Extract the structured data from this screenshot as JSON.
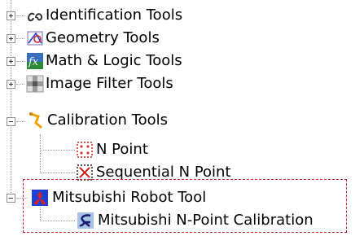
{
  "tree": {
    "items": [
      {
        "label": "Identification Tools",
        "state": "collapsed",
        "icon": "identification-icon"
      },
      {
        "label": "Geometry Tools",
        "state": "collapsed",
        "icon": "geometry-icon"
      },
      {
        "label": "Math & Logic Tools",
        "state": "collapsed",
        "icon": "math-logic-icon"
      },
      {
        "label": "Image Filter Tools",
        "state": "collapsed",
        "icon": "image-filter-icon"
      },
      {
        "label": "Calibration Tools",
        "state": "expanded",
        "icon": "calibration-icon",
        "children": [
          {
            "label": "N Point",
            "icon": "n-point-icon"
          },
          {
            "label": "Sequential N Point",
            "icon": "sequential-n-point-icon"
          }
        ]
      },
      {
        "label": "Mitsubishi Robot Tool",
        "state": "expanded",
        "icon": "mitsubishi-robot-icon",
        "children": [
          {
            "label": "Mitsubishi N-Point Calibration",
            "icon": "mitsubishi-calibration-icon"
          }
        ]
      }
    ]
  },
  "colors": {
    "highlight_border": "#d02020",
    "tree_lines": "#9a9a9a"
  }
}
